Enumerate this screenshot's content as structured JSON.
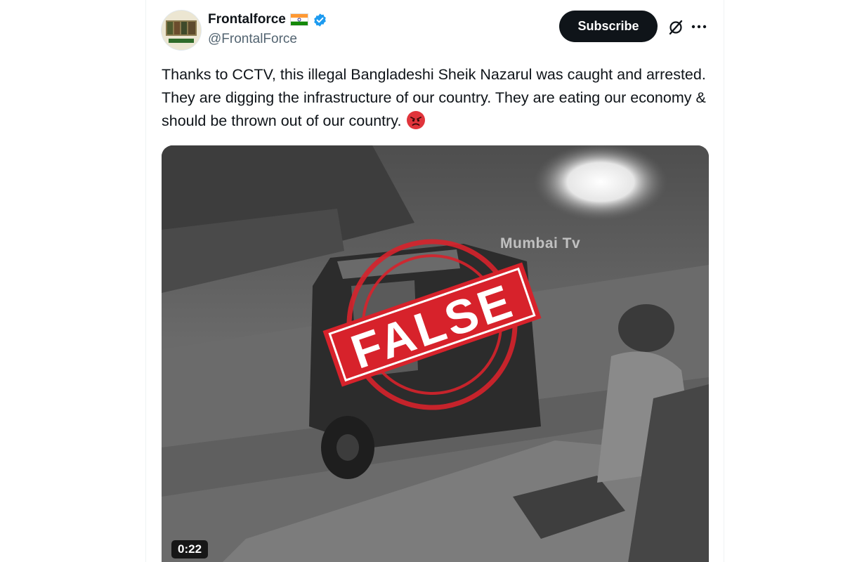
{
  "author": {
    "display_name": "Frontalforce",
    "handle": "@FrontalForce",
    "flag_icon": "india-flag-icon",
    "verified_color": "#1d9bf0"
  },
  "actions": {
    "subscribe_label": "Subscribe",
    "grok_icon": "grok-icon",
    "more_icon": "more-horizontal-icon"
  },
  "tweet": {
    "text": "Thanks to CCTV, this illegal Bangladeshi Sheik Nazarul was caught and arrested. They are digging the infrastructure of our country. They are eating our economy & should be thrown out of our country.",
    "emoji": "angry-face-emoji"
  },
  "media": {
    "watermark": "Mumbai Tv",
    "stamp_text": "FALSE",
    "stamp_color": "#d7222b",
    "duration": "0:22"
  }
}
